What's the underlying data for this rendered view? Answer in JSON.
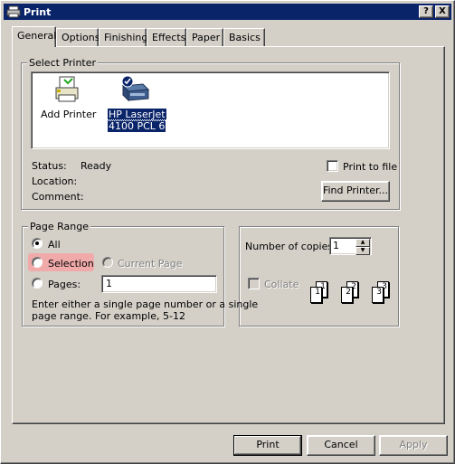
{
  "window": {
    "title": "Print",
    "help_btn": "?",
    "close_btn": "X"
  },
  "tabs": [
    "General",
    "Options",
    "Finishing",
    "Effects",
    "Paper",
    "Basics"
  ],
  "select_printer": {
    "legend": "Select Printer",
    "printers": [
      {
        "label": "Add Printer",
        "icon": "add-printer-icon"
      },
      {
        "label_line1": "HP LaserJet",
        "label_line2": "4100 PCL 6",
        "icon": "printer-icon",
        "selected": true
      }
    ],
    "status_label": "Status:",
    "status_value": "Ready",
    "location_label": "Location:",
    "comment_label": "Comment:",
    "print_to_file": "Print to file",
    "find_printer": "Find Printer..."
  },
  "page_range": {
    "legend": "Page Range",
    "all": "All",
    "selection": "Selection",
    "current_page": "Current Page",
    "pages": "Pages:",
    "pages_value": "1",
    "hint": [
      "Enter either a single page number or a single",
      "page range.  For example, 5-12"
    ]
  },
  "copies": {
    "label": "Number of copies:",
    "value": "1",
    "collate": "Collate",
    "page_labels": [
      "1",
      "1",
      "2",
      "2",
      "3",
      "3"
    ]
  },
  "buttons": {
    "print": "Print",
    "cancel": "Cancel",
    "apply": "Apply"
  },
  "colors": {
    "titlebar": "#0a246a",
    "face": "#d4d0c8",
    "highlight": "#0a246a",
    "selection_bg": "#f0aaaa"
  }
}
